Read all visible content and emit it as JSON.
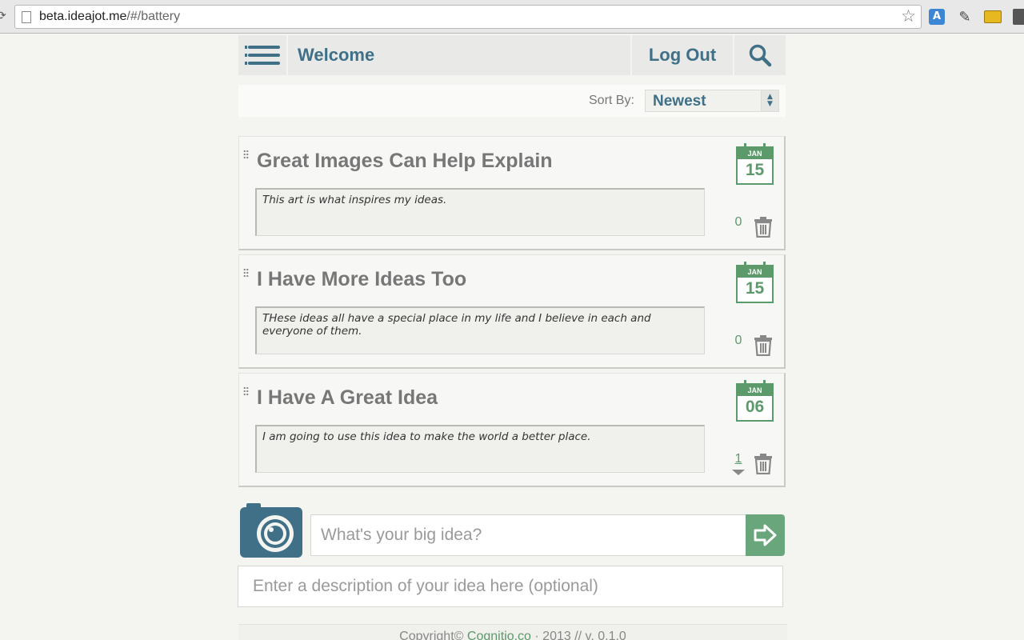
{
  "browser": {
    "url_host": "beta.ideajot.me",
    "url_path": "/#/battery"
  },
  "header": {
    "welcome": "Welcome",
    "logout": "Log Out"
  },
  "sort": {
    "label": "Sort By:",
    "value": "Newest"
  },
  "ideas": [
    {
      "title": "Great Images Can Help Explain",
      "description": "This art is what inspires my ideas.",
      "month": "JAN",
      "day": "15",
      "votes": "0"
    },
    {
      "title": "I Have More Ideas Too",
      "description": "THese ideas all have a special place in my life and I believe in each and everyone of them.",
      "month": "JAN",
      "day": "15",
      "votes": "0"
    },
    {
      "title": "I Have A Great Idea",
      "description": "I am going to use this idea to make the world a better place.",
      "month": "JAN",
      "day": "06",
      "votes": "1"
    }
  ],
  "new_idea": {
    "title_placeholder": "What's your big idea?",
    "description_placeholder": "Enter a description of your idea here (optional)"
  },
  "footer": {
    "prefix": "Copyright©",
    "link": "Cognitio.co",
    "suffix": "· 2013 // v. 0.1.0"
  },
  "colors": {
    "accent_blue": "#3f7088",
    "accent_green": "#5d9a6b"
  }
}
